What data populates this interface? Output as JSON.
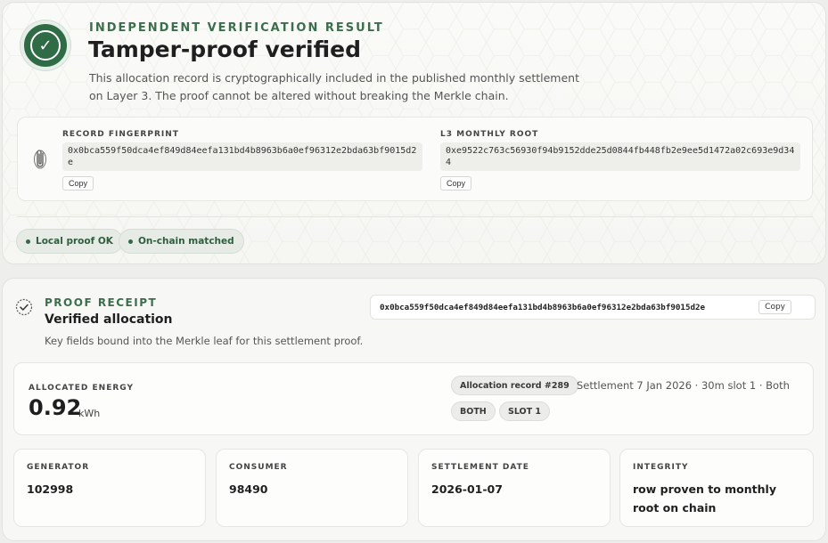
{
  "verification": {
    "eyebrow": "INDEPENDENT VERIFICATION RESULT",
    "title": "Tamper-proof verified",
    "description": "This allocation record is cryptographically included in the published monthly settlement on Layer 3. The proof cannot be altered without breaking the Merkle chain.",
    "status_icon": "check-icon",
    "record_fingerprint": {
      "label": "RECORD FINGERPRINT",
      "value": "0x0bca559f50dca4ef849d84eefa131bd4b8963b6a0ef96312e2bda63bf9015d2e",
      "copy_label": "Copy"
    },
    "monthly_root": {
      "label": "L3 MONTHLY ROOT",
      "value": "0xe9522c763c56930f94b9152dde25d0844fb448fb2e9ee5d1472a02c693e9d344",
      "copy_label": "Copy"
    },
    "pills": [
      {
        "label": "Local proof OK"
      },
      {
        "label": "On-chain matched"
      }
    ]
  },
  "receipt": {
    "eyebrow": "PROOF RECEIPT",
    "title": "Verified allocation",
    "description": "Key fields bound into the Merkle leaf for this settlement proof.",
    "hash": "0x0bca559f50dca4ef849d84eefa131bd4b8963b6a0ef96312e2bda63bf9015d2e",
    "copy_label": "Copy",
    "energy": {
      "label": "ALLOCATED ENERGY",
      "value": "0.92",
      "unit": "kWh"
    },
    "record_tag": "Allocation record #289",
    "settlement_text": "Settlement 7 Jan 2026 · 30m slot 1 · Both",
    "tags": [
      "BOTH",
      "SLOT 1"
    ],
    "stats": [
      {
        "label": "GENERATOR",
        "value": "102998"
      },
      {
        "label": "CONSUMER",
        "value": "98490"
      },
      {
        "label": "SETTLEMENT DATE",
        "value": "2026-01-07"
      },
      {
        "label": "INTEGRITY",
        "value": "row proven to monthly root on chain"
      }
    ]
  },
  "colors": {
    "accent": "#2f6b45",
    "eyebrow": "#3b6e4c"
  }
}
